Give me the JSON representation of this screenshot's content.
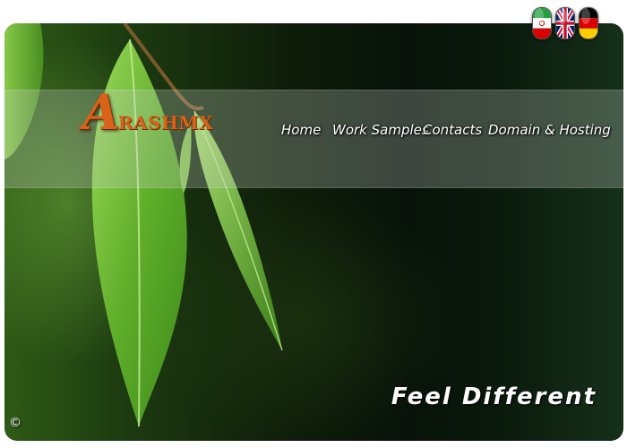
{
  "site": {
    "logo_initial": "A",
    "logo_rest": "RASHMX"
  },
  "languages": [
    {
      "icon": "iran-flag-icon"
    },
    {
      "icon": "uk-flag-icon"
    },
    {
      "icon": "germany-flag-icon"
    }
  ],
  "nav": {
    "items": [
      {
        "label": "Home"
      },
      {
        "label": "Work Samples"
      },
      {
        "label": "Contacts"
      },
      {
        "label": "Domain & Hosting"
      }
    ]
  },
  "hero": {
    "tagline": "Feel Different",
    "copyright_symbol": "©"
  },
  "colors": {
    "logo": "#d9621a",
    "nav_text": "#ffffff",
    "leaf_green": "#6fb83a"
  }
}
